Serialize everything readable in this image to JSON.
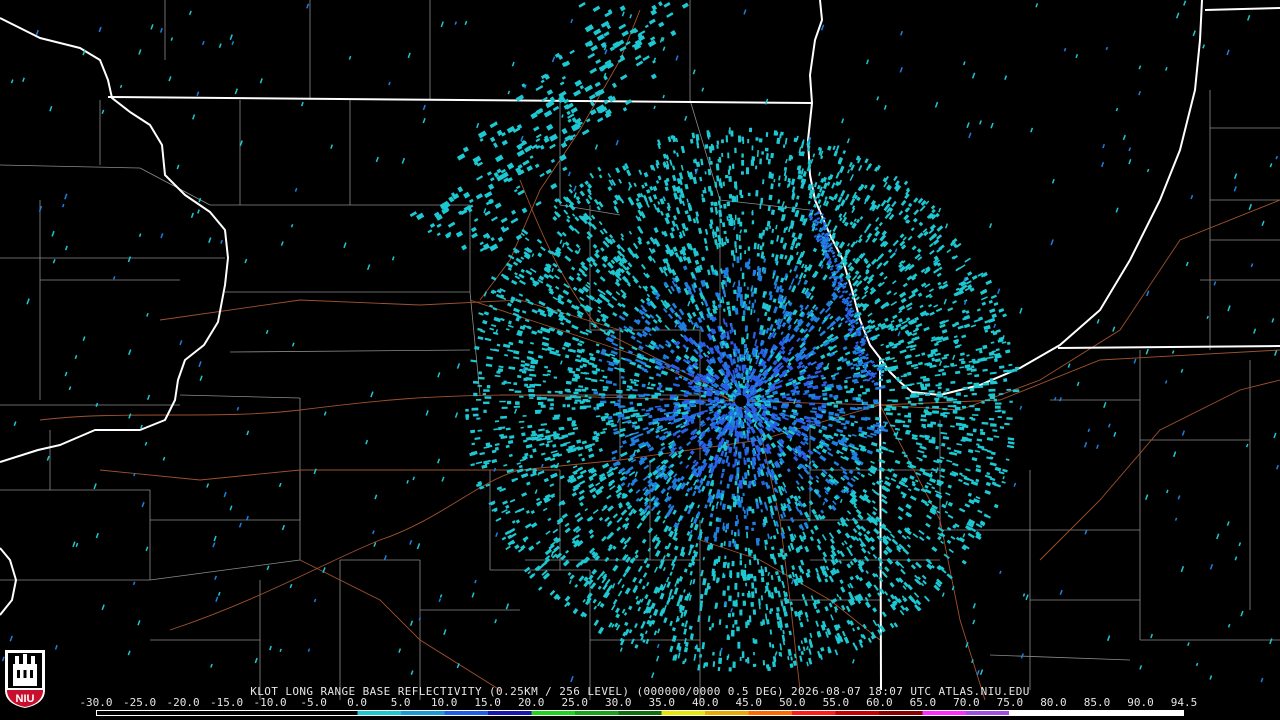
{
  "caption": "KLOT LONG RANGE BASE REFLECTIVITY (0.25KM / 256 LEVEL) (000000/0000 0.5 DEG) 2026-08-07 18:07 UTC  ATLAS.NIU.EDU",
  "legend": {
    "ticks": [
      "-30.0",
      "-25.0",
      "-20.0",
      "-15.0",
      "-10.0",
      "-5.0",
      "0.0",
      "5.0",
      "10.0",
      "15.0",
      "20.0",
      "25.0",
      "30.0",
      "35.0",
      "40.0",
      "45.0",
      "50.0",
      "55.0",
      "60.0",
      "65.0",
      "70.0",
      "75.0",
      "80.0",
      "85.0",
      "90.0",
      "94.5"
    ],
    "colors": [
      "#000000",
      "#000000",
      "#000000",
      "#000000",
      "#000000",
      "#000000",
      "#1ec8d2",
      "#1a9bd6",
      "#1f5ee8",
      "#1818b0",
      "#1fd21f",
      "#19a219",
      "#106e10",
      "#e6e600",
      "#e6aa00",
      "#ff6a00",
      "#ff1c1c",
      "#c40000",
      "#8a0000",
      "#ff2cff",
      "#a050e0",
      "#ffffff",
      "#ffffff",
      "#ffffff",
      "#ffffff"
    ]
  },
  "logo": {
    "text": "NIU"
  },
  "map": {
    "radar_site": "KLOT",
    "colors": {
      "background": "#000000",
      "state_border": "#ffffff",
      "county_border": "#8c8c8c",
      "highway": "#a0522d",
      "echo_light": "#1ec8d2",
      "echo_mid": "#1f7fe0",
      "echo_core": "#2a5ee8"
    }
  }
}
